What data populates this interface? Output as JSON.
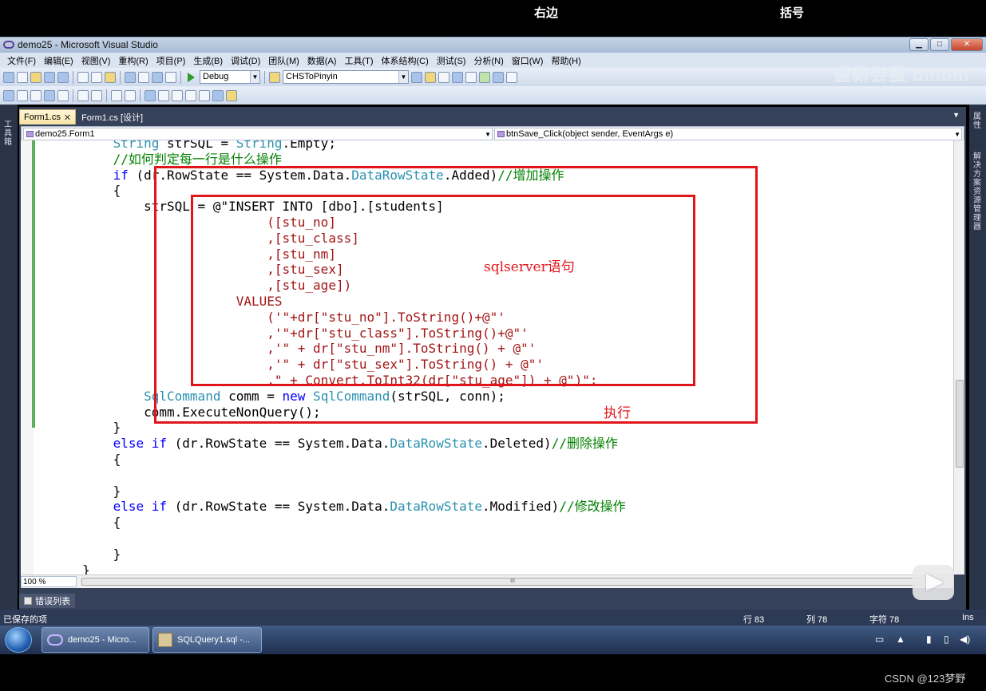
{
  "captions": {
    "left": "右边",
    "right": "括号"
  },
  "window": {
    "title": "demo25 - Microsoft Visual Studio",
    "btn_min": "▁",
    "btn_max": "□",
    "btn_close": "✕"
  },
  "menu": [
    "文件(F)",
    "编辑(E)",
    "视图(V)",
    "重构(R)",
    "项目(P)",
    "生成(B)",
    "调试(D)",
    "团队(M)",
    "数据(A)",
    "工具(T)",
    "体系结构(C)",
    "测试(S)",
    "分析(N)",
    "窗口(W)",
    "帮助(H)"
  ],
  "toolbar": {
    "config": "Debug",
    "project": "CHSToPinyin"
  },
  "watermark": "握薪尝蛋 bilibili",
  "left_strip": {
    "toolbox": "工具箱"
  },
  "right_strip": {
    "properties": "属性",
    "solution_explorer": "解决方案资源管理器"
  },
  "tabs": [
    {
      "label": "Form1.cs",
      "close": "✕"
    },
    {
      "label": "Form1.cs [设计]"
    }
  ],
  "navbar": {
    "class_combo": "demo25.Form1",
    "member_combo": "btnSave_Click(object sender, EventArgs e)"
  },
  "code_lines": [
    "            String strSQL = String.Empty;",
    "            //如何判定每一行是什么操作",
    "            if (dr.RowState == System.Data.DataRowState.Added)//增加操作",
    "            {",
    "                strSQL = @\"INSERT INTO [dbo].[students]",
    "                                ([stu_no]",
    "                                ,[stu_class]",
    "                                ,[stu_nm]",
    "                                ,[stu_sex]",
    "                                ,[stu_age])",
    "                            VALUES",
    "                                ('\"+dr[\"stu_no\"].ToString()+@\"'",
    "                                ,'\"+dr[\"stu_class\"].ToString()+@\"'",
    "                                ,'\" + dr[\"stu_nm\"].ToString() + @\"'",
    "                                ,'\" + dr[\"stu_sex\"].ToString() + @\"'",
    "                                ,\" + Convert.ToInt32(dr[\"stu_age\"]) + @\")\";",
    "                SqlCommand comm = new SqlCommand(strSQL, conn);",
    "                comm.ExecuteNonQuery();",
    "            }",
    "            else if (dr.RowState == System.Data.DataRowState.Deleted)//删除操作",
    "            {",
    "",
    "            }",
    "            else if (dr.RowState == System.Data.DataRowState.Modified)//修改操作",
    "            {",
    "",
    "            }",
    "        }"
  ],
  "annotations": {
    "sqlserver": "sqlserver语句",
    "execute": "执行"
  },
  "zoom": "100 %",
  "hscroll_grip": "III",
  "error_list": "错误列表",
  "status": {
    "message": "已保存的项",
    "line": "行 83",
    "col": "列 78",
    "ch": "字符 78",
    "mode": "Ins"
  },
  "taskbar": {
    "task1": "demo25 - Micro...",
    "task2": "SQLQuery1.sql -..."
  },
  "csdn": "CSDN @123梦野"
}
